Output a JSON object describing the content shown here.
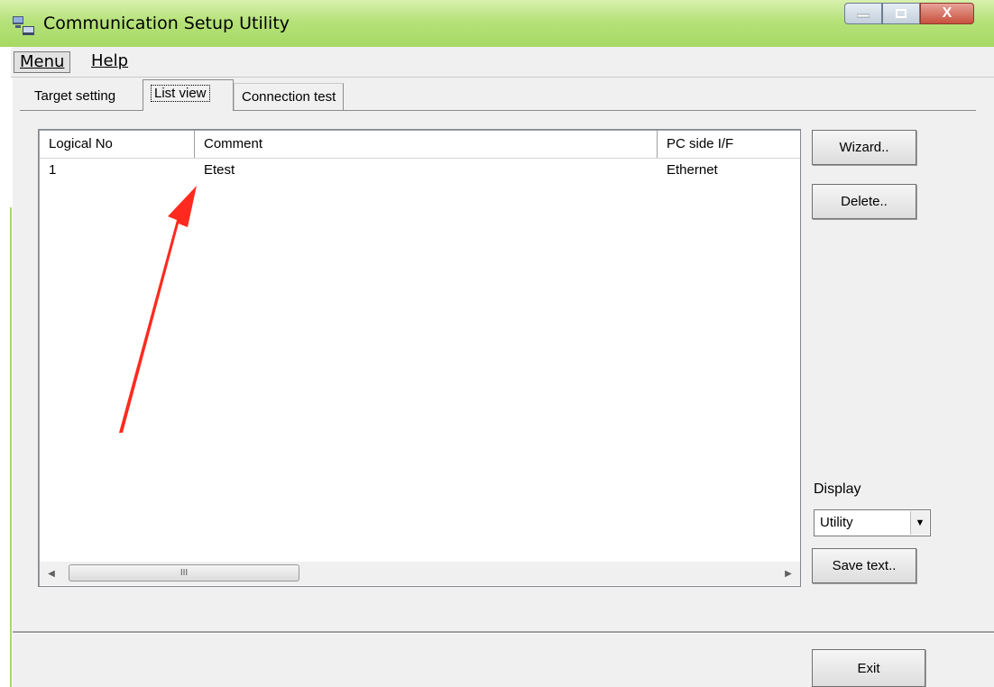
{
  "window": {
    "title": "Communication Setup Utility",
    "minimize_icon": "minimize-icon",
    "maximize_icon": "maximize-icon",
    "close_icon": "close-icon",
    "close_glyph": "X"
  },
  "menu": {
    "items": [
      {
        "label": "Menu",
        "active": true
      },
      {
        "label": "Help",
        "active": false
      }
    ]
  },
  "tabs": [
    {
      "label": "Target setting",
      "selected": false
    },
    {
      "label": "List view",
      "selected": true
    },
    {
      "label": "Connection test",
      "selected": false
    }
  ],
  "list": {
    "columns": [
      "Logical No",
      "Comment",
      "PC side I/F"
    ],
    "rows": [
      {
        "logical_no": "1",
        "comment": "Etest",
        "pc_side_if": "Ethernet"
      }
    ],
    "scroll_thumb_glyph": "III"
  },
  "buttons": {
    "wizard": "Wizard..",
    "delete": "Delete..",
    "save_text": "Save text..",
    "exit": "Exit"
  },
  "display": {
    "label": "Display",
    "selected": "Utility"
  },
  "colors": {
    "annotation_arrow": "#ff2a1f",
    "titlebar": "#b6e27a"
  }
}
